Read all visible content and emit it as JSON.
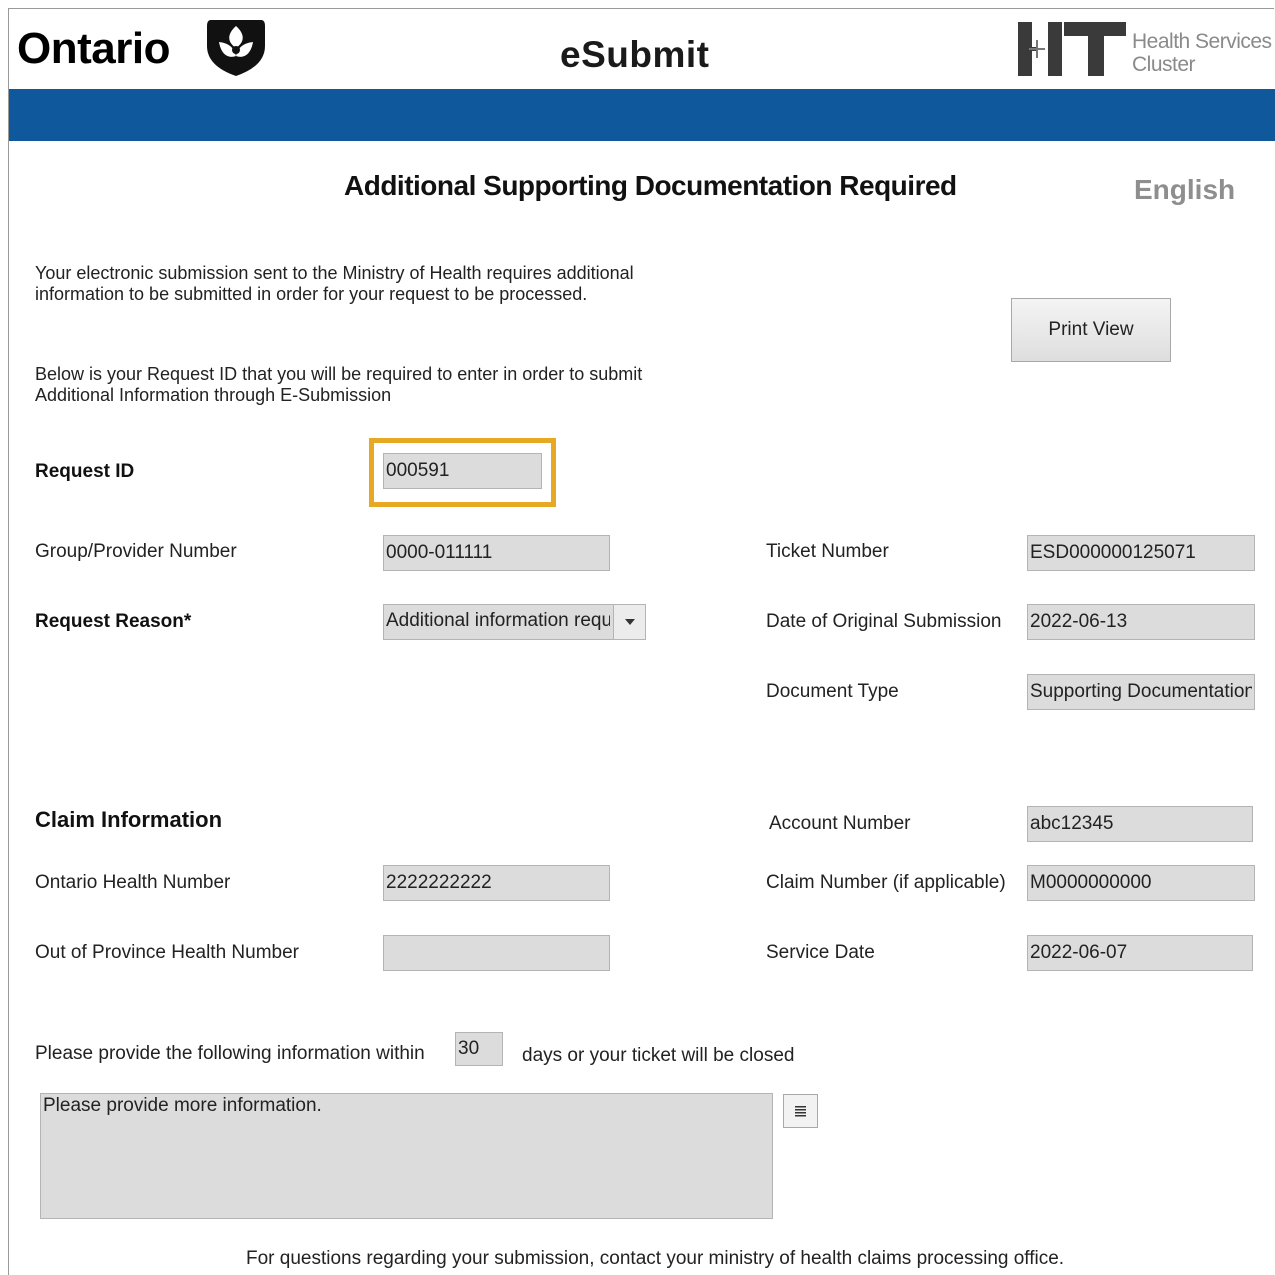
{
  "header": {
    "ontario_wordmark": "Ontario",
    "app_title": "eSubmit",
    "hit_logo_text_line1": "Health Services",
    "hit_logo_text_line2": "Cluster",
    "brand_bar_color": "#10589c"
  },
  "page": {
    "title": "Additional Supporting Documentation Required",
    "language_link": "English",
    "intro_line1": "Your electronic submission sent to the Ministry of Health requires additional",
    "intro_line2": "information to be submitted in order for your request to be processed.",
    "request_line1": "Below is your Request ID that you will be required to enter in order to submit",
    "request_line2": "Additional Information through E-Submission",
    "print_button": "Print View"
  },
  "request": {
    "request_id_label": "Request ID",
    "request_id_value": "000591",
    "highlight_color": "#e7a823",
    "group_provider_label": "Group/Provider Number",
    "group_provider_value": "0000-011111",
    "reason_label": "Request Reason*",
    "reason_value": "Additional information requested",
    "ticket_label": "Ticket Number",
    "ticket_value": "ESD000000125071",
    "orig_date_label": "Date of Original Submission",
    "orig_date_value": "2022-06-13",
    "doc_type_label": "Document Type",
    "doc_type_value": "Supporting Documentation"
  },
  "claim": {
    "section_title": "Claim Information",
    "ohn_label": "Ontario Health Number",
    "ohn_value": "2222222222",
    "oop_label": "Out of Province Health Number",
    "oop_value": "",
    "account_label": "Account Number",
    "account_value": "abc12345",
    "claim_number_label": "Claim Number (if applicable)",
    "claim_number_value": "M0000000000",
    "service_date_label": "Service Date",
    "service_date_value": "2022-06-07"
  },
  "deadline": {
    "prefix": "Please provide the following information within",
    "days_value": "30",
    "suffix": "days or your ticket will be closed",
    "message_value": "Please provide more information."
  },
  "footer": {
    "text": "For questions regarding your submission, contact your ministry of health claims processing office."
  }
}
